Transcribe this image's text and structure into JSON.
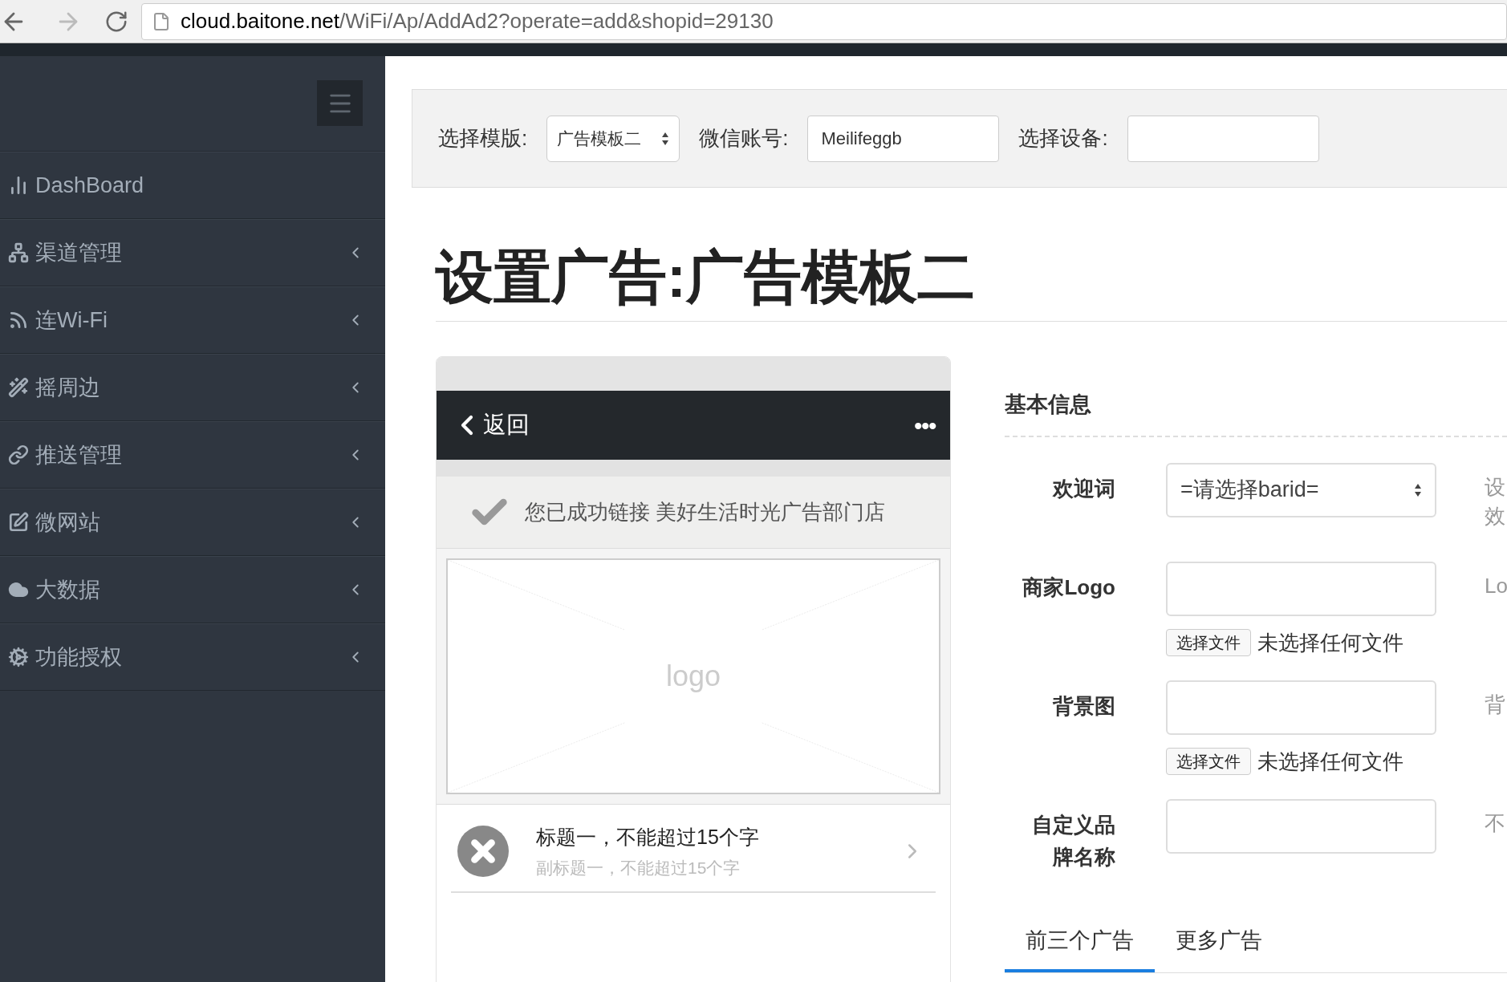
{
  "browser": {
    "url_host": "cloud.baitone.net",
    "url_path": "/WiFi/Ap/AddAd2?operate=add&shopid=29130"
  },
  "sidebar": {
    "items": [
      {
        "label": "DashBoard",
        "has_submenu": false
      },
      {
        "label": "渠道管理",
        "has_submenu": true
      },
      {
        "label": "连Wi-Fi",
        "has_submenu": true
      },
      {
        "label": "摇周边",
        "has_submenu": true
      },
      {
        "label": "推送管理",
        "has_submenu": true
      },
      {
        "label": "微网站",
        "has_submenu": true
      },
      {
        "label": "大数据",
        "has_submenu": true
      },
      {
        "label": "功能授权",
        "has_submenu": true
      }
    ]
  },
  "filter_bar": {
    "fields": [
      {
        "kind": "select",
        "label": "选择模版:",
        "value": "广告模板二"
      },
      {
        "kind": "input",
        "label": "微信账号:",
        "value": "Meilifeggb"
      },
      {
        "kind": "input",
        "label": "选择设备:"
      }
    ]
  },
  "page_title": "设置广告:广告模板二",
  "preview": {
    "back": "返回",
    "more": "•••",
    "success": "您已成功链接 美好生活时光广告部门店",
    "logo_placeholder": "logo",
    "items": [
      {
        "title": "标题一，不能超过15个字",
        "subtitle": "副标题一，不能超过15个字"
      }
    ]
  },
  "form": {
    "section": "基本信息",
    "rows": [
      {
        "kind": "select",
        "label": "欢迎词",
        "value": "=请选择barid=",
        "hint": [
          "设",
          "效"
        ]
      },
      {
        "kind": "file",
        "label": "商家Logo",
        "button": "选择文件",
        "file_status": "未选择任何文件",
        "hint": [
          "Lo"
        ]
      },
      {
        "kind": "file",
        "label": "背景图",
        "button": "选择文件",
        "file_status": "未选择任何文件",
        "hint": [
          "背"
        ]
      },
      {
        "kind": "input",
        "label": "自定义品牌名称",
        "hint": [
          "不"
        ]
      }
    ],
    "tabs": [
      {
        "label": "前三个广告",
        "selected": true
      },
      {
        "label": "更多广告",
        "selected": false
      }
    ]
  }
}
